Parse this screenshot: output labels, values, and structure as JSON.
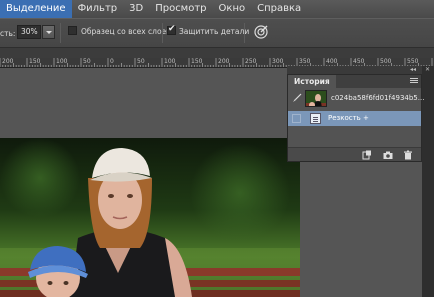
{
  "menu": {
    "items": [
      "Выделение",
      "Фильтр",
      "3D",
      "Просмотр",
      "Окно",
      "Справка"
    ],
    "active_index": 0
  },
  "options": {
    "amount_label": "сть:",
    "amount_value": "30%",
    "sample_all_layers_label": "Образец со всех слоев",
    "sample_all_layers_checked": false,
    "protect_detail_label": "Защитить детали",
    "protect_detail_checked": true
  },
  "ruler": {
    "labels": [
      "200",
      "150",
      "100",
      "50",
      "0",
      "50",
      "100",
      "150",
      "200",
      "250",
      "300",
      "350",
      "400",
      "450",
      "500",
      "550"
    ]
  },
  "history_panel": {
    "tab_label": "История",
    "collapse_label": "◂◂",
    "close_label": "✕",
    "snapshot_name": "c024ba58f6fd01f4934b5...",
    "state_label": "Резкость +"
  },
  "colors": {
    "menu_active": "#3b6fb3",
    "history_selected": "#7b97b9"
  }
}
